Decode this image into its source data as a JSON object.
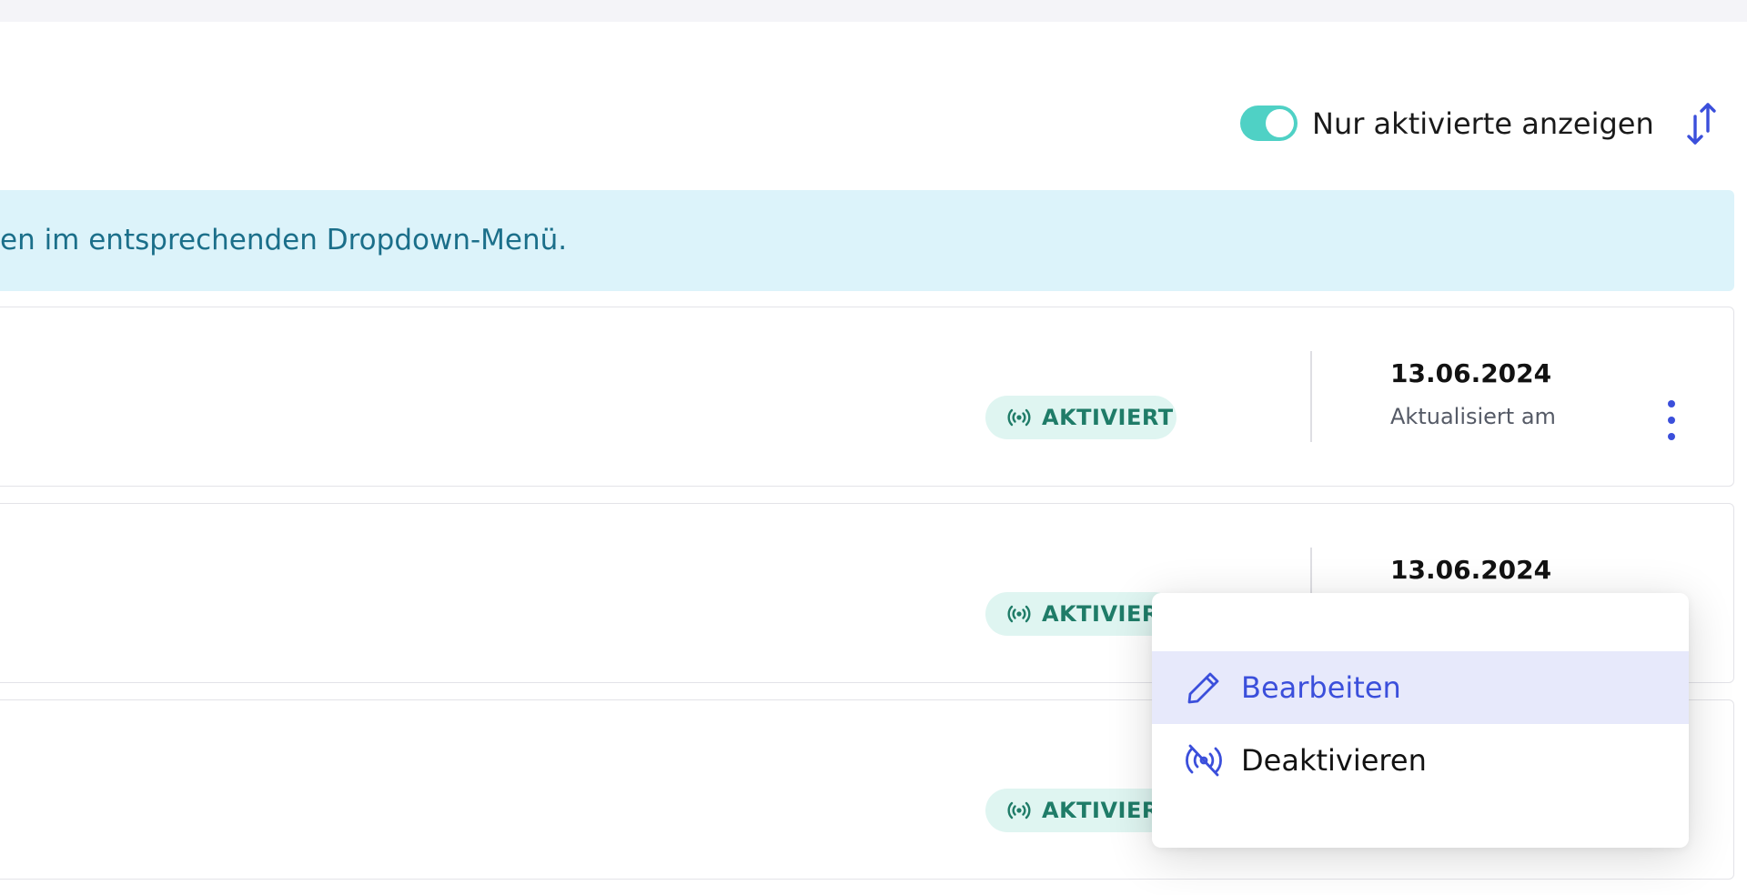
{
  "toolbar": {
    "toggle_label": "Nur aktivierte anzeigen",
    "toggle_on": true,
    "toggle_icon": "toggle-switch-icon",
    "sort_icon": "sort-arrows-icon"
  },
  "banner": {
    "text": "en im entsprechenden Dropdown-Menü."
  },
  "rows": [
    {
      "status": "AKTIVIERT",
      "date": "13.06.2024",
      "date_caption": "Aktualisiert am"
    },
    {
      "status": "AKTIVIERT",
      "date": "13.06.2024",
      "date_caption": ""
    },
    {
      "status": "AKTIVIERT",
      "date": "",
      "date_caption": ""
    }
  ],
  "menu": {
    "items": [
      {
        "label": "Bearbeiten",
        "icon": "pencil-icon"
      },
      {
        "label": "Deaktivieren",
        "icon": "broadcast-off-icon"
      }
    ]
  },
  "colors": {
    "accent": "#3b4fdb",
    "toggle_on": "#4fd1c5",
    "banner_bg": "#dcf3fa",
    "banner_text": "#1b6f8a",
    "badge_bg": "#dff5f1",
    "badge_text": "#1f7c68",
    "menu_active_bg": "#e7e9fb"
  }
}
